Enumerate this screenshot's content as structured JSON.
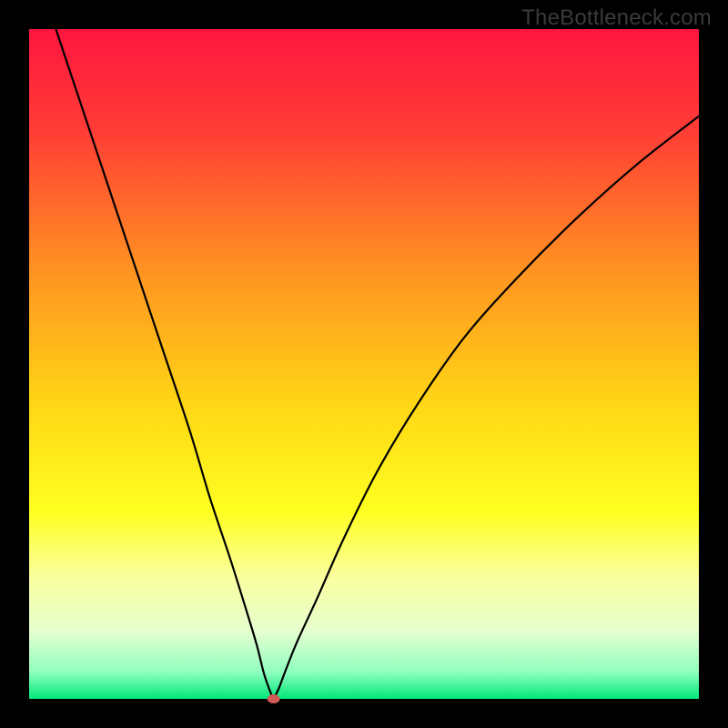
{
  "watermark": "TheBottleneck.com",
  "chart_data": {
    "type": "line",
    "title": "",
    "xlabel": "",
    "ylabel": "",
    "xlim": [
      0,
      100
    ],
    "ylim": [
      0,
      100
    ],
    "grid": false,
    "legend": false,
    "background_gradient": {
      "stops": [
        {
          "offset": 0,
          "color": "#ff163f"
        },
        {
          "offset": 15,
          "color": "#ff3c36"
        },
        {
          "offset": 35,
          "color": "#ff8f22"
        },
        {
          "offset": 55,
          "color": "#ffd315"
        },
        {
          "offset": 72,
          "color": "#ffff20"
        },
        {
          "offset": 82,
          "color": "#faffa0"
        },
        {
          "offset": 90,
          "color": "#e6ffd0"
        },
        {
          "offset": 96,
          "color": "#8fffbf"
        },
        {
          "offset": 100,
          "color": "#00e879"
        }
      ]
    },
    "series": [
      {
        "name": "bottleneck-curve",
        "x": [
          4,
          8,
          12,
          16,
          20,
          24,
          27,
          30,
          32.5,
          34,
          35,
          35.8,
          36.3,
          36.5,
          36.7,
          37.3,
          38.2,
          40,
          43,
          47,
          52,
          58,
          65,
          73,
          82,
          91,
          100
        ],
        "y": [
          100,
          88,
          76,
          64,
          52,
          40,
          30,
          21,
          13,
          8,
          4,
          1.6,
          0.4,
          0,
          0.4,
          1.6,
          4,
          8.5,
          15,
          24,
          34,
          44,
          54,
          63,
          72,
          80,
          87
        ]
      }
    ],
    "marker": {
      "name": "min-point",
      "x": 36.5,
      "y": 0,
      "color": "#d15a55",
      "rx": 7,
      "ry": 5
    }
  }
}
